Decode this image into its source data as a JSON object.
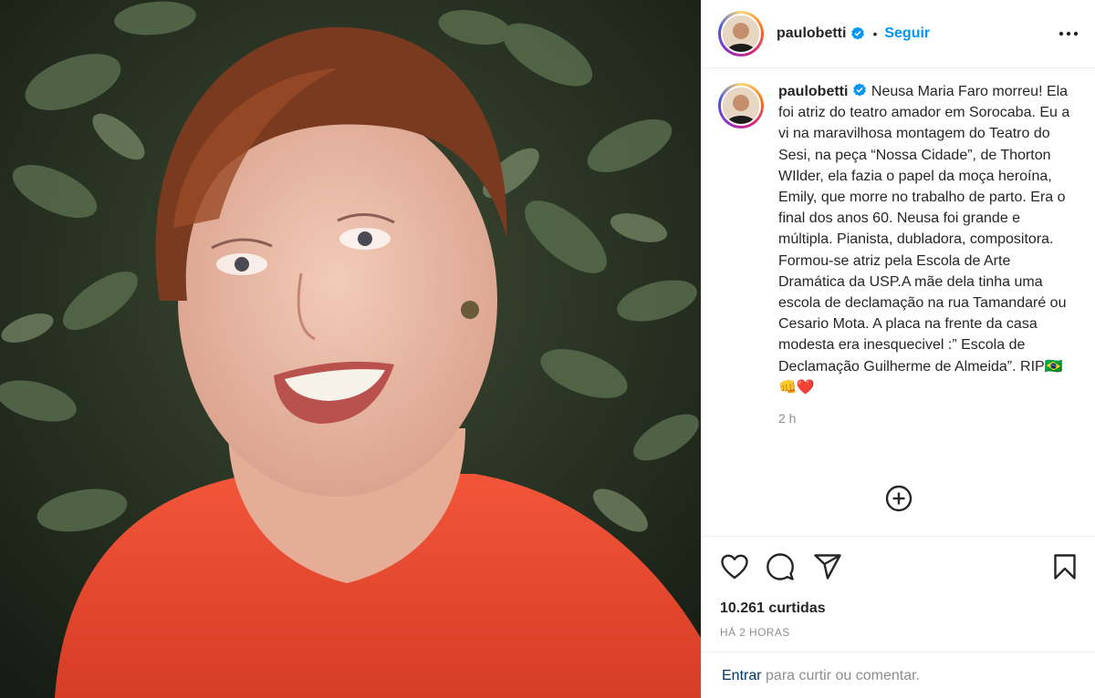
{
  "post": {
    "username": "paulobetti",
    "follow_label": "Seguir",
    "separator": "•",
    "caption_lead": "Neusa Maria Faro morreu! Ela foi atriz do teatro amador em Sorocaba. Eu a vi na maravilhosa montagem do Teatro do Sesi, na peça “Nossa Cidade”, de Thorton WIlder, ela fazia o papel da moça heroína, Emily, que morre no trabalho de parto. Era o final dos anos 60. Neusa foi grande e múltipla. Pianista, dubladora, compositora. Formou-se atriz pela Escola de Arte Dramática da USP.A mãe dela tinha uma escola de declamação na rua Tamandaré ou Cesario Mota. A placa na frente da casa modesta era inesquecivel :” Escola de Declamação Guilherme de Almeida”. RIP",
    "caption_emoji": "🇧🇷👊❤️",
    "caption_time": "2 h",
    "likes": "10.261 curtidas",
    "time_ago": "HÁ 2 HORAS",
    "login_link": "Entrar",
    "login_text": " para curtir ou comentar."
  },
  "icons": {
    "verified": "verified-badge",
    "more": "more-options",
    "add_comment": "plus-circle",
    "like": "heart",
    "comment": "speech-bubble",
    "share": "paper-plane",
    "save": "bookmark"
  },
  "colors": {
    "link_blue": "#0095f6",
    "dark_link": "#00376b",
    "muted": "#8e8e8e",
    "dress_red": "#e8452c"
  }
}
